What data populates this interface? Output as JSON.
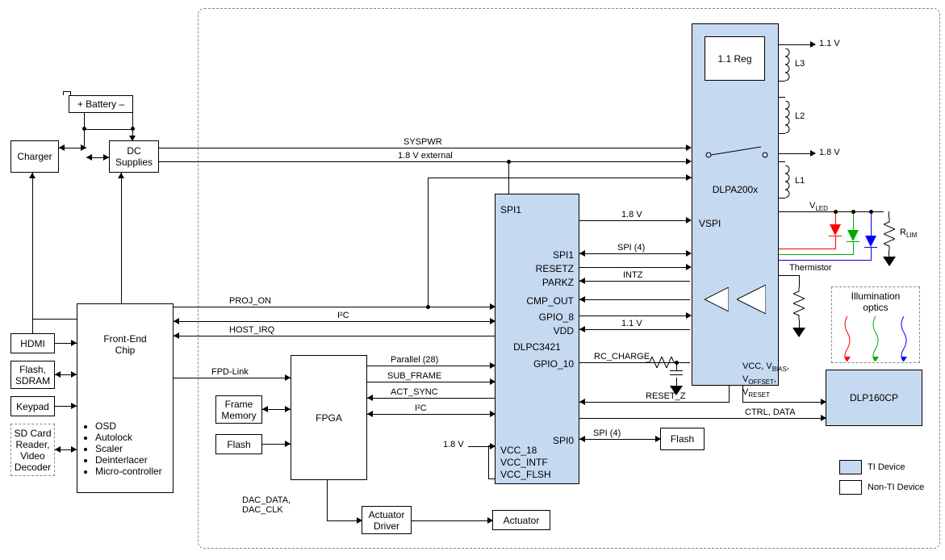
{
  "blocks": {
    "battery": "+ Battery –",
    "charger": "Charger",
    "dc_supplies": "DC\nSupplies",
    "hdmi": "HDMI",
    "flash_sdram": "Flash,\nSDRAM",
    "keypad": "Keypad",
    "sdcard": "SD Card\nReader,\nVideo\nDecoder",
    "front_end": "Front-End\nChip",
    "front_end_bullets": [
      "OSD",
      "Autolock",
      "Scaler",
      "Deinterlacer",
      "Micro-controller"
    ],
    "fpga": "FPGA",
    "frame_memory": "Frame\nMemory",
    "flash_fpga": "Flash",
    "actuator_driver": "Actuator\nDriver",
    "actuator": "Actuator",
    "flash_spi": "Flash",
    "dlpc3421": "DLPC3421",
    "reg_11": "1.1 Reg",
    "dlpa200x": "DLPA200x",
    "dlp160cp": "DLP160CP",
    "illum_optics": "Illumination\noptics"
  },
  "ports": {
    "spi1": "SPI1",
    "resetz": "RESETZ",
    "parkz": "PARKZ",
    "cmp_out": "CMP_OUT",
    "gpio_8": "GPIO_8",
    "vdd": "VDD",
    "gpio_10": "GPIO_10",
    "spi0": "SPI0",
    "vcc_18": "VCC_18",
    "vcc_int": "VCC_INTF",
    "vcc_flsh": "VCC_FLSH",
    "vspi": "VSPI"
  },
  "signals": {
    "syspwr": "SYSPWR",
    "v18_ext": "1.8 V external",
    "proj_on": "PROJ_ON",
    "i2c": "I²C",
    "host_irq": "HOST_IRQ",
    "fpd_link": "FPD-Link",
    "parallel28": "Parallel (28)",
    "sub_frame": "SUB_FRAME",
    "act_sync": "ACT_SYNC",
    "i2c2": "I²C",
    "dac": "DAC_DATA,\nDAC_CLK",
    "v18": "1.8 V",
    "v11": "1.1 V",
    "spi4": "SPI (4)",
    "intz": "INTZ",
    "rc_charge": "RC_CHARGE",
    "reset_z": "RESET_Z",
    "ctrl_data": "CTRL, DATA",
    "vcc_bias": "VCC, V",
    "bias_sub": "BIAS",
    "voffset": "V",
    "offset_sub": "OFFSET",
    "vreset": "V",
    "reset_sub": "RESET",
    "vled": "V",
    "led_sub": "LED",
    "rlim": "R",
    "lim_sub": "LIM",
    "thermistor": "Thermistor",
    "l1": "L1",
    "l2": "L2",
    "l3": "L3"
  },
  "legend": {
    "ti": "TI Device",
    "nonti": "Non-TI Device"
  },
  "chart_data": {
    "type": "table",
    "description": "Block diagram of DLP projector system. Signal connections between blocks.",
    "nodes": [
      {
        "id": "battery",
        "label": "+ Battery –",
        "type": "non-ti"
      },
      {
        "id": "charger",
        "label": "Charger",
        "type": "non-ti"
      },
      {
        "id": "dc_supplies",
        "label": "DC Supplies",
        "type": "non-ti"
      },
      {
        "id": "hdmi",
        "label": "HDMI",
        "type": "non-ti"
      },
      {
        "id": "flash_sdram",
        "label": "Flash, SDRAM",
        "type": "non-ti"
      },
      {
        "id": "keypad",
        "label": "Keypad",
        "type": "non-ti"
      },
      {
        "id": "sdcard",
        "label": "SD Card Reader, Video Decoder",
        "type": "non-ti",
        "dashed": true
      },
      {
        "id": "front_end",
        "label": "Front-End Chip",
        "type": "non-ti",
        "features": [
          "OSD",
          "Autolock",
          "Scaler",
          "Deinterlacer",
          "Micro-controller"
        ]
      },
      {
        "id": "fpga",
        "label": "FPGA",
        "type": "non-ti"
      },
      {
        "id": "frame_memory",
        "label": "Frame Memory",
        "type": "non-ti"
      },
      {
        "id": "flash_fpga",
        "label": "Flash",
        "type": "non-ti"
      },
      {
        "id": "actuator_driver",
        "label": "Actuator Driver",
        "type": "non-ti"
      },
      {
        "id": "actuator",
        "label": "Actuator",
        "type": "non-ti"
      },
      {
        "id": "flash_spi",
        "label": "Flash",
        "type": "non-ti"
      },
      {
        "id": "dlpc3421",
        "label": "DLPC3421",
        "type": "ti",
        "ports": [
          "SPI1",
          "RESETZ",
          "PARKZ",
          "CMP_OUT",
          "GPIO_8",
          "VDD",
          "GPIO_10",
          "SPI0",
          "VCC_18",
          "VCC_INTF",
          "VCC_FLSH"
        ]
      },
      {
        "id": "dlpa200x",
        "label": "DLPA200x",
        "type": "ti",
        "internal": [
          "1.1 Reg",
          "switch"
        ],
        "ports": [
          "VSPI"
        ]
      },
      {
        "id": "dlp160cp",
        "label": "DLP160CP",
        "type": "ti"
      },
      {
        "id": "illum_optics",
        "label": "Illumination optics",
        "type": "non-ti",
        "dashed": true
      }
    ],
    "edges": [
      {
        "from": "charger",
        "to": "battery",
        "bidir": true
      },
      {
        "from": "charger",
        "to": "dc_supplies",
        "bidir": true
      },
      {
        "from": "dc_supplies",
        "to": "battery"
      },
      {
        "from": "dc_supplies",
        "to": "dlpa200x",
        "label": "SYSPWR"
      },
      {
        "from": "dc_supplies",
        "to": "dlpa200x",
        "label": "1.8 V external"
      },
      {
        "from": "hdmi",
        "to": "front_end"
      },
      {
        "from": "flash_sdram",
        "to": "front_end",
        "bidir": true
      },
      {
        "from": "keypad",
        "to": "front_end"
      },
      {
        "from": "sdcard",
        "to": "front_end",
        "bidir": true
      },
      {
        "from": "front_end",
        "to": "dlpc3421",
        "label": "PROJ_ON"
      },
      {
        "from": "front_end",
        "to": "dlpc3421",
        "label": "I²C",
        "bidir": true
      },
      {
        "from": "dlpc3421",
        "to": "front_end",
        "label": "HOST_IRQ"
      },
      {
        "from": "front_end",
        "to": "fpga",
        "label": "FPD-Link"
      },
      {
        "from": "front_end",
        "to": "charger"
      },
      {
        "from": "front_end",
        "to": "dc_supplies"
      },
      {
        "from": "frame_memory",
        "to": "fpga",
        "bidir": true
      },
      {
        "from": "flash_fpga",
        "to": "fpga"
      },
      {
        "from": "fpga",
        "to": "dlpc3421",
        "label": "Parallel (28)"
      },
      {
        "from": "fpga",
        "to": "dlpc3421",
        "label": "SUB_FRAME"
      },
      {
        "from": "dlpc3421",
        "to": "fpga",
        "label": "ACT_SYNC"
      },
      {
        "from": "fpga",
        "to": "dlpc3421",
        "label": "I²C",
        "bidir": true
      },
      {
        "from": "fpga",
        "to": "actuator_driver",
        "label": "DAC_DATA, DAC_CLK"
      },
      {
        "from": "actuator_driver",
        "to": "actuator"
      },
      {
        "from": "dlpc3421",
        "to": "dlpa200x",
        "label": "1.8 V",
        "port": "VSPI"
      },
      {
        "from": "dlpc3421",
        "to": "dlpa200x",
        "label": "SPI (4)",
        "port": "SPI1",
        "bidir": true
      },
      {
        "from": "dlpc3421",
        "to": "dlpa200x",
        "port": "RESETZ"
      },
      {
        "from": "dlpa200x",
        "to": "dlpc3421",
        "label": "INTZ",
        "port": "PARKZ"
      },
      {
        "from": "dlpa200x",
        "to": "dlpc3421",
        "port": "CMP_OUT"
      },
      {
        "from": "dlpc3421",
        "to": "dlpa200x",
        "port": "GPIO_8"
      },
      {
        "from": "dlpa200x",
        "to": "dlpc3421",
        "label": "1.1 V",
        "port": "VDD"
      },
      {
        "from": "dlpc3421",
        "to": "rc",
        "label": "RC_CHARGE",
        "port": "GPIO_10"
      },
      {
        "from": "dlpc3421",
        "to": "flash_spi",
        "label": "SPI (4)",
        "port": "SPI0",
        "bidir": true
      },
      {
        "from": "dlpa200x",
        "to": "dlp160cp",
        "label": "RESET_Z"
      },
      {
        "from": "dlpc3421",
        "to": "dlp160cp",
        "label": "CTRL, DATA"
      },
      {
        "from": "dlpa200x",
        "to": "dlp160cp",
        "label": "VCC, VBIAS, VOFFSET, VRESET"
      },
      {
        "from": "dlpa200x",
        "to": "ext",
        "label": "1.1 V"
      },
      {
        "from": "dlpa200x",
        "to": "ext",
        "label": "1.8 V"
      },
      {
        "from": "dlpa200x",
        "to": "leds",
        "label": "VLED"
      },
      {
        "from": "dlpa200x",
        "to": "thermistor",
        "label": "Thermistor"
      },
      {
        "from": "leds",
        "to": "illum_optics"
      }
    ],
    "external_components": [
      "L1",
      "L2",
      "L3",
      "RLIM",
      "Thermistor",
      "RGB LEDs",
      "RC network"
    ]
  }
}
